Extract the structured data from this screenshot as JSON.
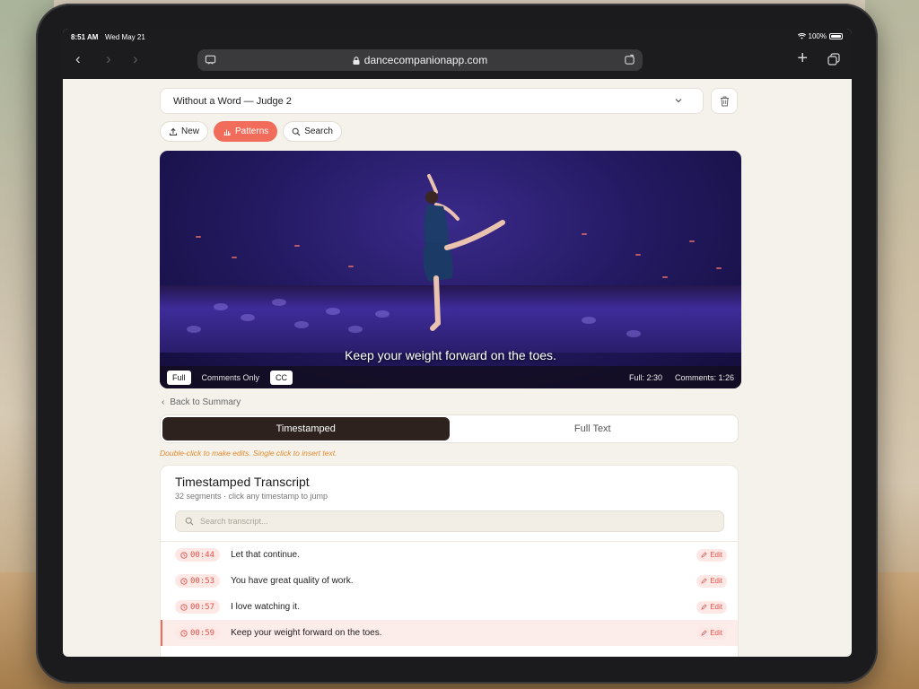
{
  "status": {
    "time": "8:51 AM",
    "date": "Wed May 21",
    "battery": "100%"
  },
  "browser": {
    "url": "dancecompanionapp.com"
  },
  "toolbar": {
    "project_select": "Without a Word — Judge 2",
    "new_label": "New",
    "patterns_label": "Patterns",
    "search_label": "Search"
  },
  "video": {
    "caption": "Keep your weight forward on the toes.",
    "mode_full": "Full",
    "mode_comments": "Comments Only",
    "cc_label": "CC",
    "full_time": "Full: 2:30",
    "comments_time": "Comments: 1:26"
  },
  "back_link": "Back to Summary",
  "view_tabs": {
    "timestamped": "Timestamped",
    "full_text": "Full Text"
  },
  "hint": "Double-click to make edits. Single click to insert text.",
  "transcript": {
    "title": "Timestamped Transcript",
    "subtitle": "32 segments · click any timestamp to jump",
    "search_placeholder": "Search transcript...",
    "edit_label": "Edit",
    "rows": [
      {
        "time": "00:44",
        "text": "Let that continue."
      },
      {
        "time": "00:53",
        "text": "You have great quality of work."
      },
      {
        "time": "00:57",
        "text": "I love watching it."
      },
      {
        "time": "00:59",
        "text": "Keep your weight forward on the toes."
      }
    ]
  },
  "colors": {
    "accent": "#f26c5c",
    "dark": "#2d221d",
    "hint": "#e08a2c"
  }
}
